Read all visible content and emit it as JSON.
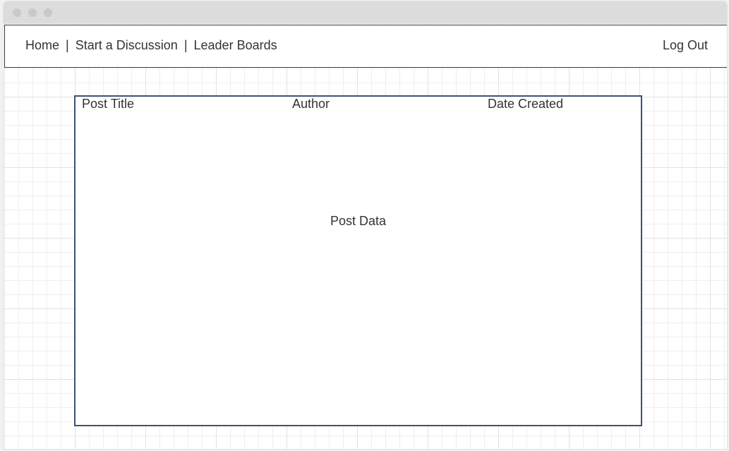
{
  "nav": {
    "links": [
      "Home",
      "Start a Discussion",
      "Leader Boards"
    ],
    "separator": "|",
    "logout_label": "Log Out"
  },
  "post": {
    "columns": {
      "title": "Post Title",
      "author": "Author",
      "date": "Date Created"
    },
    "body": "Post Data"
  },
  "colors": {
    "panel_border": "#3e5172",
    "text": "#333333",
    "titlebar": "#dcdcdc"
  }
}
